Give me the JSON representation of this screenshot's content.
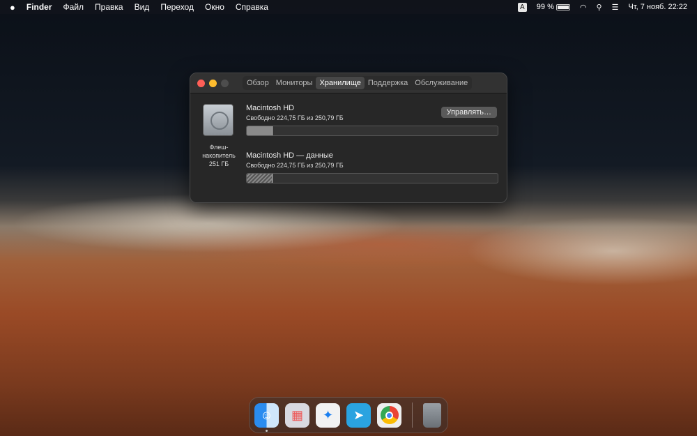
{
  "menubar": {
    "apple": "",
    "app": "Finder",
    "items": [
      "Файл",
      "Правка",
      "Вид",
      "Переход",
      "Окно",
      "Справка"
    ],
    "input_source": "A",
    "battery": "99 %",
    "battery_level": 0.99,
    "datetime": "Чт, 7 нояб.  22:22"
  },
  "window": {
    "tabs": [
      "Обзор",
      "Мониторы",
      "Хранилище",
      "Поддержка",
      "Обслуживание"
    ],
    "active_tab": "Хранилище",
    "disk": {
      "label_line1": "Флеш-",
      "label_line2": "накопитель",
      "label_line3": "251 ГБ"
    },
    "manage_button": "Управлять…",
    "volumes": [
      {
        "name": "Macintosh HD",
        "free": "Свободно 224,75 ГБ из 250,79 ГБ",
        "used_fraction": 0.104
      },
      {
        "name": "Macintosh HD — данные",
        "free": "Свободно 224,75 ГБ из 250,79 ГБ",
        "used_fraction": 0.104
      }
    ]
  },
  "dock": [
    "Finder",
    "Launchpad",
    "Safari",
    "Telegram",
    "Google Chrome",
    "Корзина"
  ]
}
